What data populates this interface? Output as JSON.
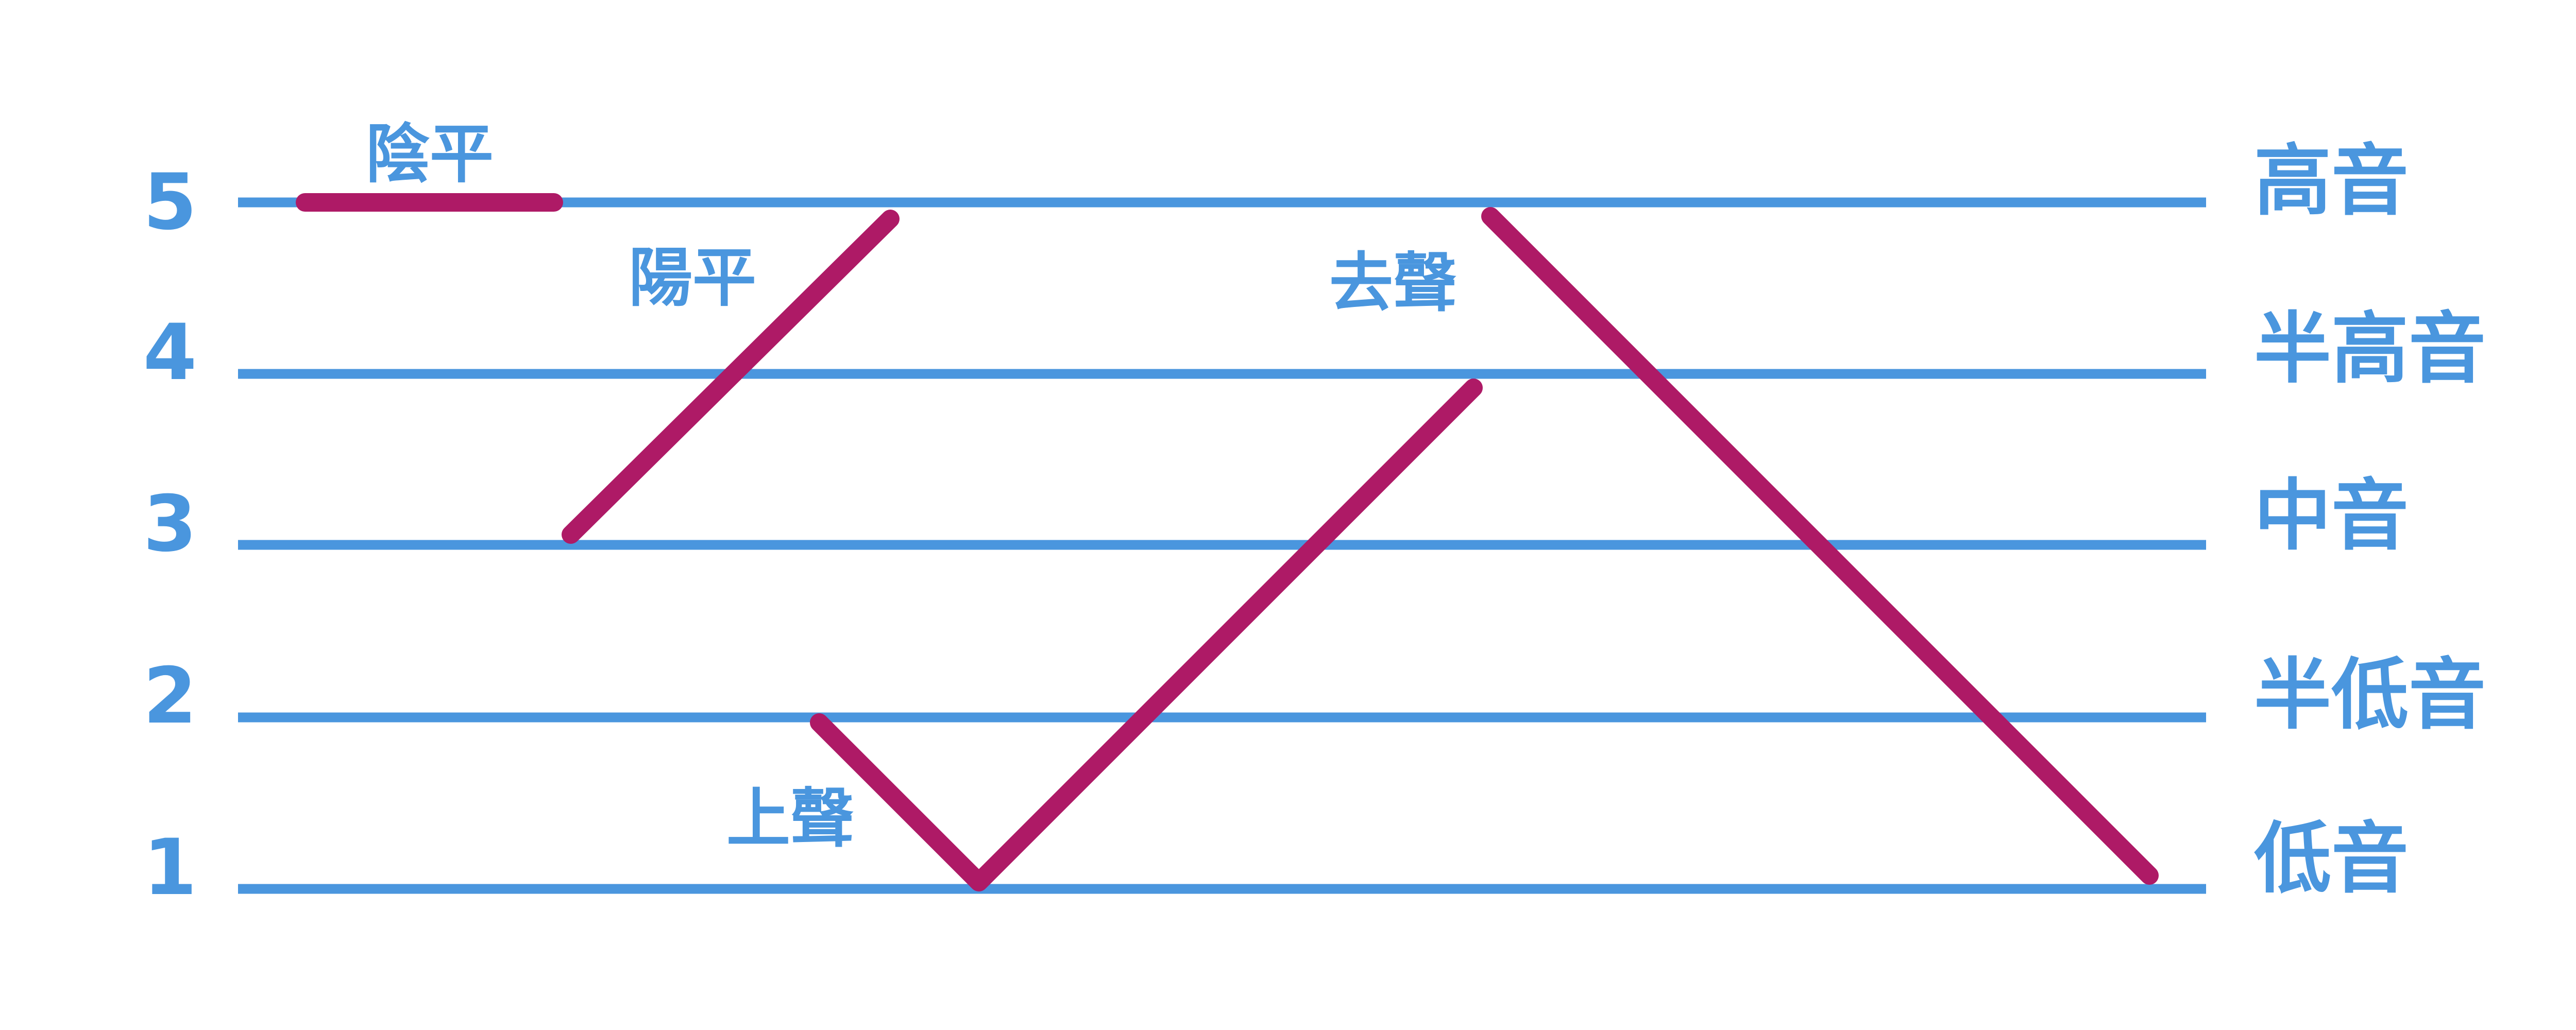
{
  "colors": {
    "lines": "#4a96de",
    "text": "#4a96de",
    "contours": "#ae1a66",
    "background": "#ffffff"
  },
  "levels": [
    {
      "number": "5",
      "name": "高音"
    },
    {
      "number": "4",
      "name": "半高音"
    },
    {
      "number": "3",
      "name": "中音"
    },
    {
      "number": "2",
      "name": "半低音"
    },
    {
      "number": "1",
      "name": "低音"
    }
  ],
  "tones": [
    {
      "name": "陰平",
      "contour": [
        5,
        5
      ]
    },
    {
      "name": "陽平",
      "contour": [
        3,
        5
      ]
    },
    {
      "name": "上聲",
      "contour": [
        2,
        1,
        4
      ]
    },
    {
      "name": "去聲",
      "contour": [
        5,
        1
      ]
    }
  ]
}
